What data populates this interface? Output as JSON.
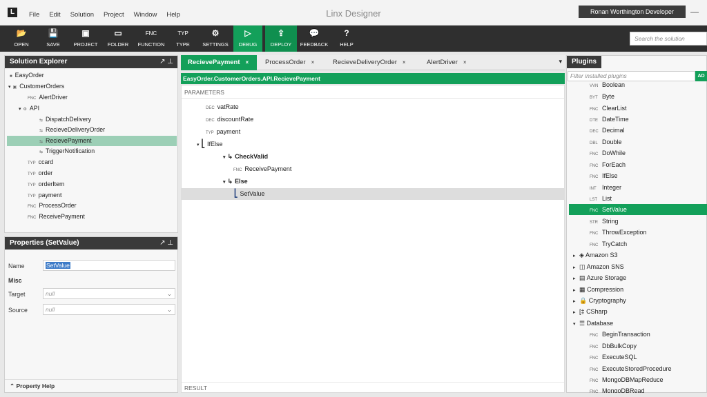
{
  "title_bar": {
    "logo": "L",
    "menus": [
      "File",
      "Edit",
      "Solution",
      "Project",
      "Window",
      "Help"
    ],
    "app_title": "Linx Designer",
    "user": "Ronan Worthington Developer",
    "minimize": "—"
  },
  "toolbar": {
    "buttons": [
      {
        "icon": "📂",
        "label": "OPEN"
      },
      {
        "icon": "💾",
        "label": "SAVE"
      },
      {
        "icon": "▣",
        "label": "PROJECT"
      },
      {
        "icon": "▭",
        "label": "FOLDER"
      },
      {
        "icon": "FNC",
        "label": "FUNCTION"
      },
      {
        "icon": "TYP",
        "label": "TYPE"
      },
      {
        "icon": "⚙",
        "label": "SETTINGS"
      },
      {
        "icon": "▷",
        "label": "DEBUG"
      },
      {
        "icon": "⇪",
        "label": "DEPLOY"
      },
      {
        "icon": "💬",
        "label": "FEEDBACK"
      },
      {
        "icon": "?",
        "label": "HELP"
      }
    ],
    "search_placeholder": "Search the solution"
  },
  "solution_explorer": {
    "title": "Solution Explorer",
    "pins": "↗ ⊥",
    "items": [
      {
        "tag": "",
        "label": "EasyOrder"
      },
      {
        "tag": "",
        "label": "CustomerOrders"
      },
      {
        "tag": "FNC",
        "label": "AlertDriver"
      },
      {
        "tag": "",
        "label": "API"
      },
      {
        "tag": "",
        "label": "DispatchDelivery"
      },
      {
        "tag": "",
        "label": "RecieveDeliveryOrder"
      },
      {
        "tag": "",
        "label": "RecievePayment"
      },
      {
        "tag": "",
        "label": "TriggerNotification"
      },
      {
        "tag": "TYP",
        "label": "ccard"
      },
      {
        "tag": "TYP",
        "label": "order"
      },
      {
        "tag": "TYP",
        "label": "orderItem"
      },
      {
        "tag": "TYP",
        "label": "payment"
      },
      {
        "tag": "FNC",
        "label": "ProcessOrder"
      },
      {
        "tag": "FNC",
        "label": "ReceivePayment"
      }
    ]
  },
  "properties": {
    "title": "Properties (SetValue)",
    "pins": "↗ ⊥",
    "name_label": "Name",
    "name_value": "SetValue",
    "misc_label": "Misc",
    "target_label": "Target",
    "target_value": "null",
    "source_label": "Source",
    "source_value": "null",
    "help_label": "Property Help",
    "help_arrow": "⌃"
  },
  "editor": {
    "tabs": [
      {
        "label": "RecievePayment",
        "close": "×"
      },
      {
        "label": "ProcessOrder",
        "close": "×"
      },
      {
        "label": "RecieveDeliveryOrder",
        "close": "×"
      },
      {
        "label": "AlertDriver",
        "close": "×"
      }
    ],
    "tab_overflow": "▾",
    "path": "EasyOrder.CustomerOrders.API.RecievePayment",
    "parameters_label": "PARAMETERS",
    "result_label": "RESULT",
    "rows": [
      {
        "tag": "DEC",
        "label": "vatRate"
      },
      {
        "tag": "DEC",
        "label": "discountRate"
      },
      {
        "tag": "TYP",
        "label": "payment"
      },
      {
        "tag": "",
        "label": "IfElse"
      },
      {
        "tag": "↳",
        "label": "CheckValid"
      },
      {
        "tag": "FNC",
        "label": "ReceivePayment"
      },
      {
        "tag": "↳",
        "label": "Else"
      },
      {
        "tag": "",
        "label": "SetValue"
      }
    ]
  },
  "plugins": {
    "title": "Plugins",
    "filter_placeholder": "Filter installed plugins",
    "add": "AD",
    "items": [
      {
        "tag": "VVN",
        "label": "Boolean"
      },
      {
        "tag": "BYT",
        "label": "Byte"
      },
      {
        "tag": "FNC",
        "label": "ClearList"
      },
      {
        "tag": "DTE",
        "label": "DateTime"
      },
      {
        "tag": "DEC",
        "label": "Decimal"
      },
      {
        "tag": "DBL",
        "label": "Double"
      },
      {
        "tag": "FNC",
        "label": "DoWhile"
      },
      {
        "tag": "FNC",
        "label": "ForEach"
      },
      {
        "tag": "FNC",
        "label": "IfElse"
      },
      {
        "tag": "INT",
        "label": "Integer"
      },
      {
        "tag": "LST",
        "label": "List"
      },
      {
        "tag": "FNC",
        "label": "SetValue"
      },
      {
        "tag": "STR",
        "label": "String"
      },
      {
        "tag": "FNC",
        "label": "ThrowException"
      },
      {
        "tag": "FNC",
        "label": "TryCatch"
      },
      {
        "tag": "",
        "label": "Amazon S3"
      },
      {
        "tag": "",
        "label": "Amazon SNS"
      },
      {
        "tag": "",
        "label": "Azure Storage"
      },
      {
        "tag": "",
        "label": "Compression"
      },
      {
        "tag": "",
        "label": "Cryptography"
      },
      {
        "tag": "",
        "label": "CSharp"
      },
      {
        "tag": "",
        "label": "Database"
      },
      {
        "tag": "FNC",
        "label": "BeginTransaction"
      },
      {
        "tag": "FNC",
        "label": "DbBulkCopy"
      },
      {
        "tag": "FNC",
        "label": "ExecuteSQL"
      },
      {
        "tag": "FNC",
        "label": "ExecuteStoredProcedure"
      },
      {
        "tag": "FNC",
        "label": "MongoDBMapReduce"
      },
      {
        "tag": "FNC",
        "label": "MongoDBRead"
      }
    ]
  },
  "colors": {
    "accent": "#13a05a",
    "toolbar": "#2f2f2f",
    "selection": "#9ccfb6"
  }
}
